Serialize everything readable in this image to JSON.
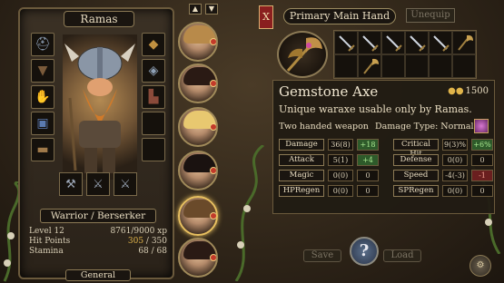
{
  "character": {
    "name": "Ramas",
    "class_title": "Warrior / Berserker",
    "stats": [
      {
        "label": "Level 12",
        "value": "8761/9000 xp"
      },
      {
        "label": "Hit Points",
        "value_current": "305",
        "value_max": " / 350"
      },
      {
        "label": "Stamina",
        "value": "68 / 68"
      }
    ],
    "tab_label": "General",
    "left_slots": [
      "helmet-icon",
      "cloak-icon",
      "gloves-icon",
      "armor-icon",
      "belt-icon"
    ],
    "right_slots": [
      "amulet-icon",
      "chest-armor-icon",
      "boots-icon",
      "ring-icon",
      "ring-icon"
    ],
    "bottom_slots": [
      "axe-icon",
      "shield-icon",
      "empty-slot-icon"
    ]
  },
  "party": {
    "scroll_up": "▲",
    "scroll_down": "▼",
    "members": [
      {
        "hair": "#b88a4a",
        "selected": false
      },
      {
        "hair": "#2a1a14",
        "selected": false
      },
      {
        "hair": "#e8c870",
        "selected": false
      },
      {
        "hair": "#1a1210",
        "selected": false
      },
      {
        "hair": "#6a4a2a",
        "selected": true
      },
      {
        "hair": "#2a1a14",
        "selected": false
      }
    ]
  },
  "equip_panel": {
    "close_label": "X",
    "mode_title": "Primary Main Hand",
    "unequip_label": "Unequip",
    "weapon_slots": [
      "sword-icon",
      "sword-icon",
      "sword-icon",
      "sword-icon",
      "sword-icon",
      "axe-icon",
      "empty",
      "axe-icon",
      "empty",
      "empty",
      "empty",
      "empty"
    ]
  },
  "item": {
    "name": "Gemstone Axe",
    "price": "1500",
    "description": "Unique waraxe usable only by Ramas.",
    "hands": "Two handed weapon",
    "damage_type": "Damage Type: Normal",
    "stats_left": [
      {
        "label": "Damage",
        "value": "36(8)",
        "delta": "+18",
        "delta_kind": "plus"
      },
      {
        "label": "Attack",
        "value": "5(1)",
        "delta": "+4",
        "delta_kind": "plus"
      },
      {
        "label": "Magic",
        "value": "0(0)",
        "delta": "0",
        "delta_kind": "neutral"
      },
      {
        "label": "HPRegen",
        "value": "0(0)",
        "delta": "0",
        "delta_kind": "neutral"
      }
    ],
    "stats_right": [
      {
        "label": "Critical Hit",
        "value": "9(3)%",
        "delta": "+6%",
        "delta_kind": "plus"
      },
      {
        "label": "Defense",
        "value": "0(0)",
        "delta": "0",
        "delta_kind": "neutral"
      },
      {
        "label": "Speed",
        "value": "-4(-3)",
        "delta": "-1",
        "delta_kind": "minus"
      },
      {
        "label": "SPRegen",
        "value": "0(0)",
        "delta": "0",
        "delta_kind": "neutral"
      }
    ]
  },
  "footer": {
    "save_label": "Save",
    "load_label": "Load",
    "help_label": "?"
  },
  "colors": {
    "accent_gold": "#e0b44a",
    "positive": "#2e5a2a",
    "negative": "#6a1f1f"
  }
}
